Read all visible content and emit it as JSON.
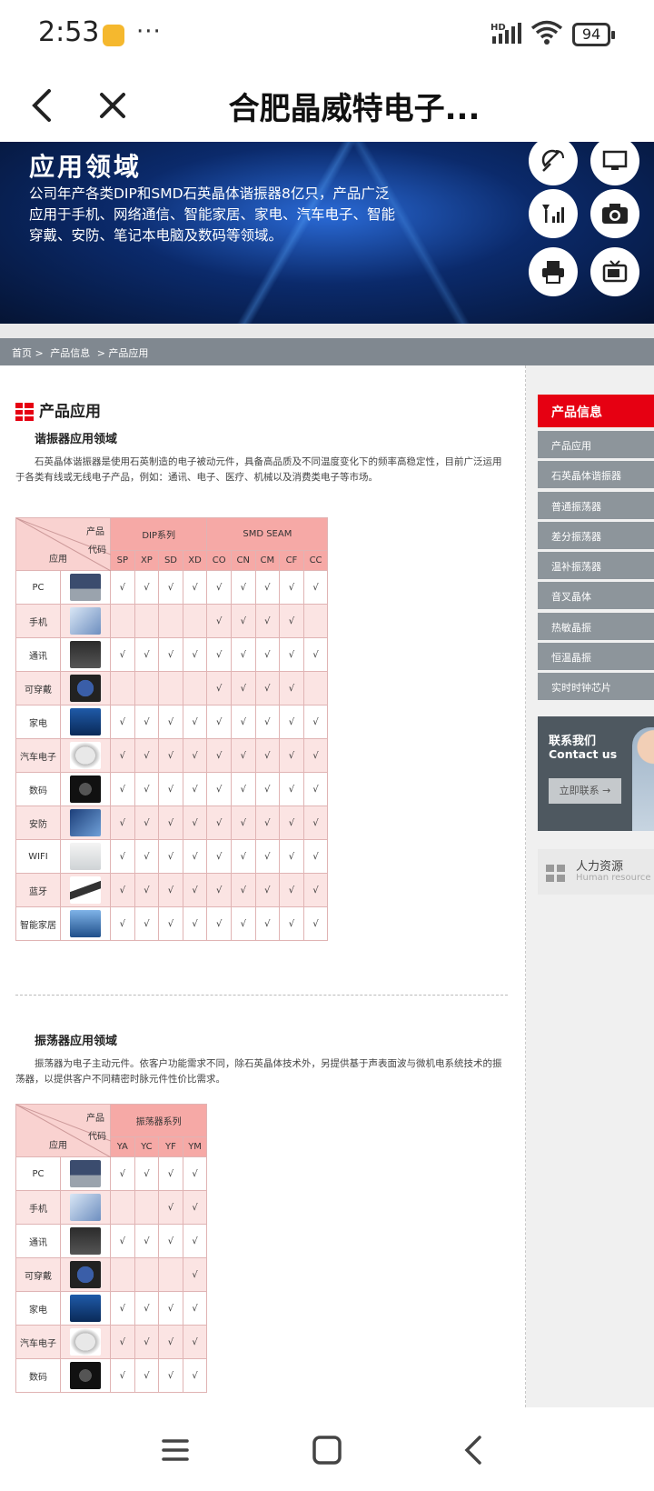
{
  "status": {
    "time": "2:53",
    "more": "···",
    "battery": "94",
    "network": "HD"
  },
  "topbar": {
    "title": "合肥晶威特电子..."
  },
  "banner": {
    "heading": "应用领域",
    "text": "公司年产各类DIP和SMD石英晶体谐振器8亿只，产品广泛应用于手机、网络通信、智能家居、家电、汽车电子、智能穿戴、安防、笔记本电脑及数码等领域。"
  },
  "breadcrumb": {
    "home": "首页 >",
    "product": "产品信息",
    "current": "> 产品应用"
  },
  "section": {
    "title": "产品应用"
  },
  "resonator": {
    "heading": "谐振器应用领域",
    "desc": "石英晶体谐振器是使用石英制造的电子被动元件，具备高品质及不同温度变化下的频率高稳定性，目前广泛运用于各类有线或无线电子产品，例如：通讯、电子、医疗、机械以及消费类电子等市场。",
    "corner_product": "产品",
    "corner_code": "代码",
    "corner_app": "应用",
    "group1": "DIP系列",
    "group2": "SMD SEAM",
    "codes": [
      "SP",
      "XP",
      "SD",
      "XD",
      "CO",
      "CN",
      "CM",
      "CF",
      "CC"
    ],
    "rows": [
      {
        "label": "PC",
        "checks": [
          "√",
          "√",
          "√",
          "√",
          "√",
          "√",
          "√",
          "√",
          "√"
        ]
      },
      {
        "label": "手机",
        "checks": [
          "",
          "",
          "",
          "",
          "√",
          "√",
          "√",
          "√",
          ""
        ]
      },
      {
        "label": "通讯",
        "checks": [
          "√",
          "√",
          "√",
          "√",
          "√",
          "√",
          "√",
          "√",
          "√"
        ]
      },
      {
        "label": "可穿戴",
        "checks": [
          "",
          "",
          "",
          "",
          "√",
          "√",
          "√",
          "√",
          ""
        ]
      },
      {
        "label": "家电",
        "checks": [
          "√",
          "√",
          "√",
          "√",
          "√",
          "√",
          "√",
          "√",
          "√"
        ]
      },
      {
        "label": "汽车电子",
        "checks": [
          "√",
          "√",
          "√",
          "√",
          "√",
          "√",
          "√",
          "√",
          "√"
        ]
      },
      {
        "label": "数码",
        "checks": [
          "√",
          "√",
          "√",
          "√",
          "√",
          "√",
          "√",
          "√",
          "√"
        ]
      },
      {
        "label": "安防",
        "checks": [
          "√",
          "√",
          "√",
          "√",
          "√",
          "√",
          "√",
          "√",
          "√"
        ]
      },
      {
        "label": "WIFI",
        "checks": [
          "√",
          "√",
          "√",
          "√",
          "√",
          "√",
          "√",
          "√",
          "√"
        ]
      },
      {
        "label": "蓝牙",
        "checks": [
          "√",
          "√",
          "√",
          "√",
          "√",
          "√",
          "√",
          "√",
          "√"
        ]
      },
      {
        "label": "智能家居",
        "checks": [
          "√",
          "√",
          "√",
          "√",
          "√",
          "√",
          "√",
          "√",
          "√"
        ]
      }
    ]
  },
  "oscillator": {
    "heading": "振荡器应用领域",
    "desc": "振荡器为电子主动元件。依客户功能需求不同，除石英晶体技术外，另提供基于声表面波与微机电系统技术的振荡器，以提供客户不同精密时脉元件性价比需求。",
    "corner_product": "产品",
    "corner_code": "代码",
    "corner_app": "应用",
    "group1": "振荡器系列",
    "codes": [
      "YA",
      "YC",
      "YF",
      "YM"
    ],
    "rows": [
      {
        "label": "PC",
        "checks": [
          "√",
          "√",
          "√",
          "√"
        ]
      },
      {
        "label": "手机",
        "checks": [
          "",
          "",
          "√",
          "√"
        ]
      },
      {
        "label": "通讯",
        "checks": [
          "√",
          "√",
          "√",
          "√"
        ]
      },
      {
        "label": "可穿戴",
        "checks": [
          "",
          "",
          "",
          "√"
        ]
      },
      {
        "label": "家电",
        "checks": [
          "√",
          "√",
          "√",
          "√"
        ]
      },
      {
        "label": "汽车电子",
        "checks": [
          "√",
          "√",
          "√",
          "√"
        ]
      },
      {
        "label": "数码",
        "checks": [
          "√",
          "√",
          "√",
          "√"
        ]
      }
    ]
  },
  "sidebar": {
    "head": "产品信息",
    "items": [
      "产品应用",
      "石英晶体谐振器",
      "普通振荡器",
      "差分振荡器",
      "温补振荡器",
      "音叉晶体",
      "热敏晶振",
      "恒温晶振",
      "实时时钟芯片"
    ],
    "contact_cn": "联系我们",
    "contact_en": "Contact us",
    "contact_btn": "立即联系 →",
    "hr_cn": "人力资源",
    "hr_en": "Human resource"
  },
  "colors": {
    "accent": "#e60012",
    "menu": "#8d959b",
    "table_head": "#f6a9a6",
    "table_pink": "#fbe4e3"
  },
  "icons": [
    "back-arrow-icon",
    "close-icon",
    "menu-icon",
    "home-square-icon",
    "back-chevron-icon"
  ]
}
